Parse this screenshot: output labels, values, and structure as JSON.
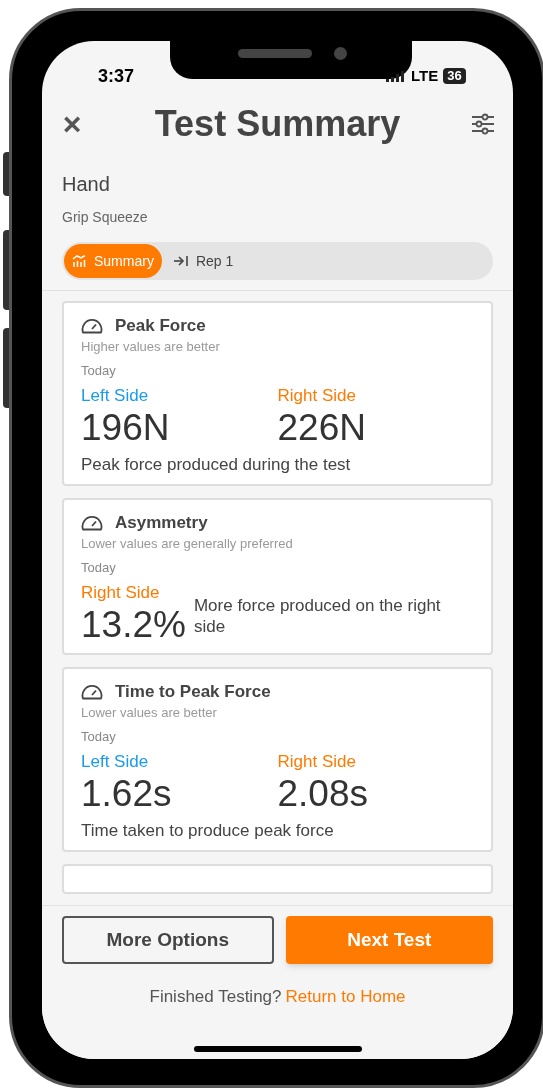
{
  "status_bar": {
    "time": "3:37",
    "network": "LTE",
    "battery": "36"
  },
  "header": {
    "close": "×",
    "title": "Test Summary"
  },
  "test": {
    "region": "Hand",
    "name": "Grip Squeeze"
  },
  "tabs": [
    {
      "label": "Summary",
      "selected": true
    },
    {
      "label": "Rep 1",
      "selected": false
    }
  ],
  "cards": [
    {
      "kind": "sides",
      "title": "Peak Force",
      "hint": "Higher values are better",
      "period": "Today",
      "sides": [
        {
          "label": "Left Side",
          "value": "196N",
          "color": "#1a9bf0"
        },
        {
          "label": "Right Side",
          "value": "226N",
          "color": "#ff7a00"
        }
      ],
      "description": "Peak force produced during the test"
    },
    {
      "kind": "single",
      "title": "Asymmetry",
      "hint": "Lower values are generally preferred",
      "period": "Today",
      "sides": [
        {
          "label": "Right Side",
          "value": "13.2%",
          "color": "#ff7a00"
        }
      ],
      "description": "More force produced on the right side"
    },
    {
      "kind": "sides",
      "title": "Time to Peak Force",
      "hint": "Lower values are better",
      "period": "Today",
      "sides": [
        {
          "label": "Left Side",
          "value": "1.62s",
          "color": "#1a9bf0"
        },
        {
          "label": "Right Side",
          "value": "2.08s",
          "color": "#ff7a00"
        }
      ],
      "description": "Time taken to produce peak force"
    }
  ],
  "footer": {
    "buttons": [
      {
        "label": "More Options",
        "kind": "outline"
      },
      {
        "label": "Next Test",
        "kind": "primary"
      }
    ],
    "prompt": "Finished Testing?",
    "link": "Return to Home"
  }
}
